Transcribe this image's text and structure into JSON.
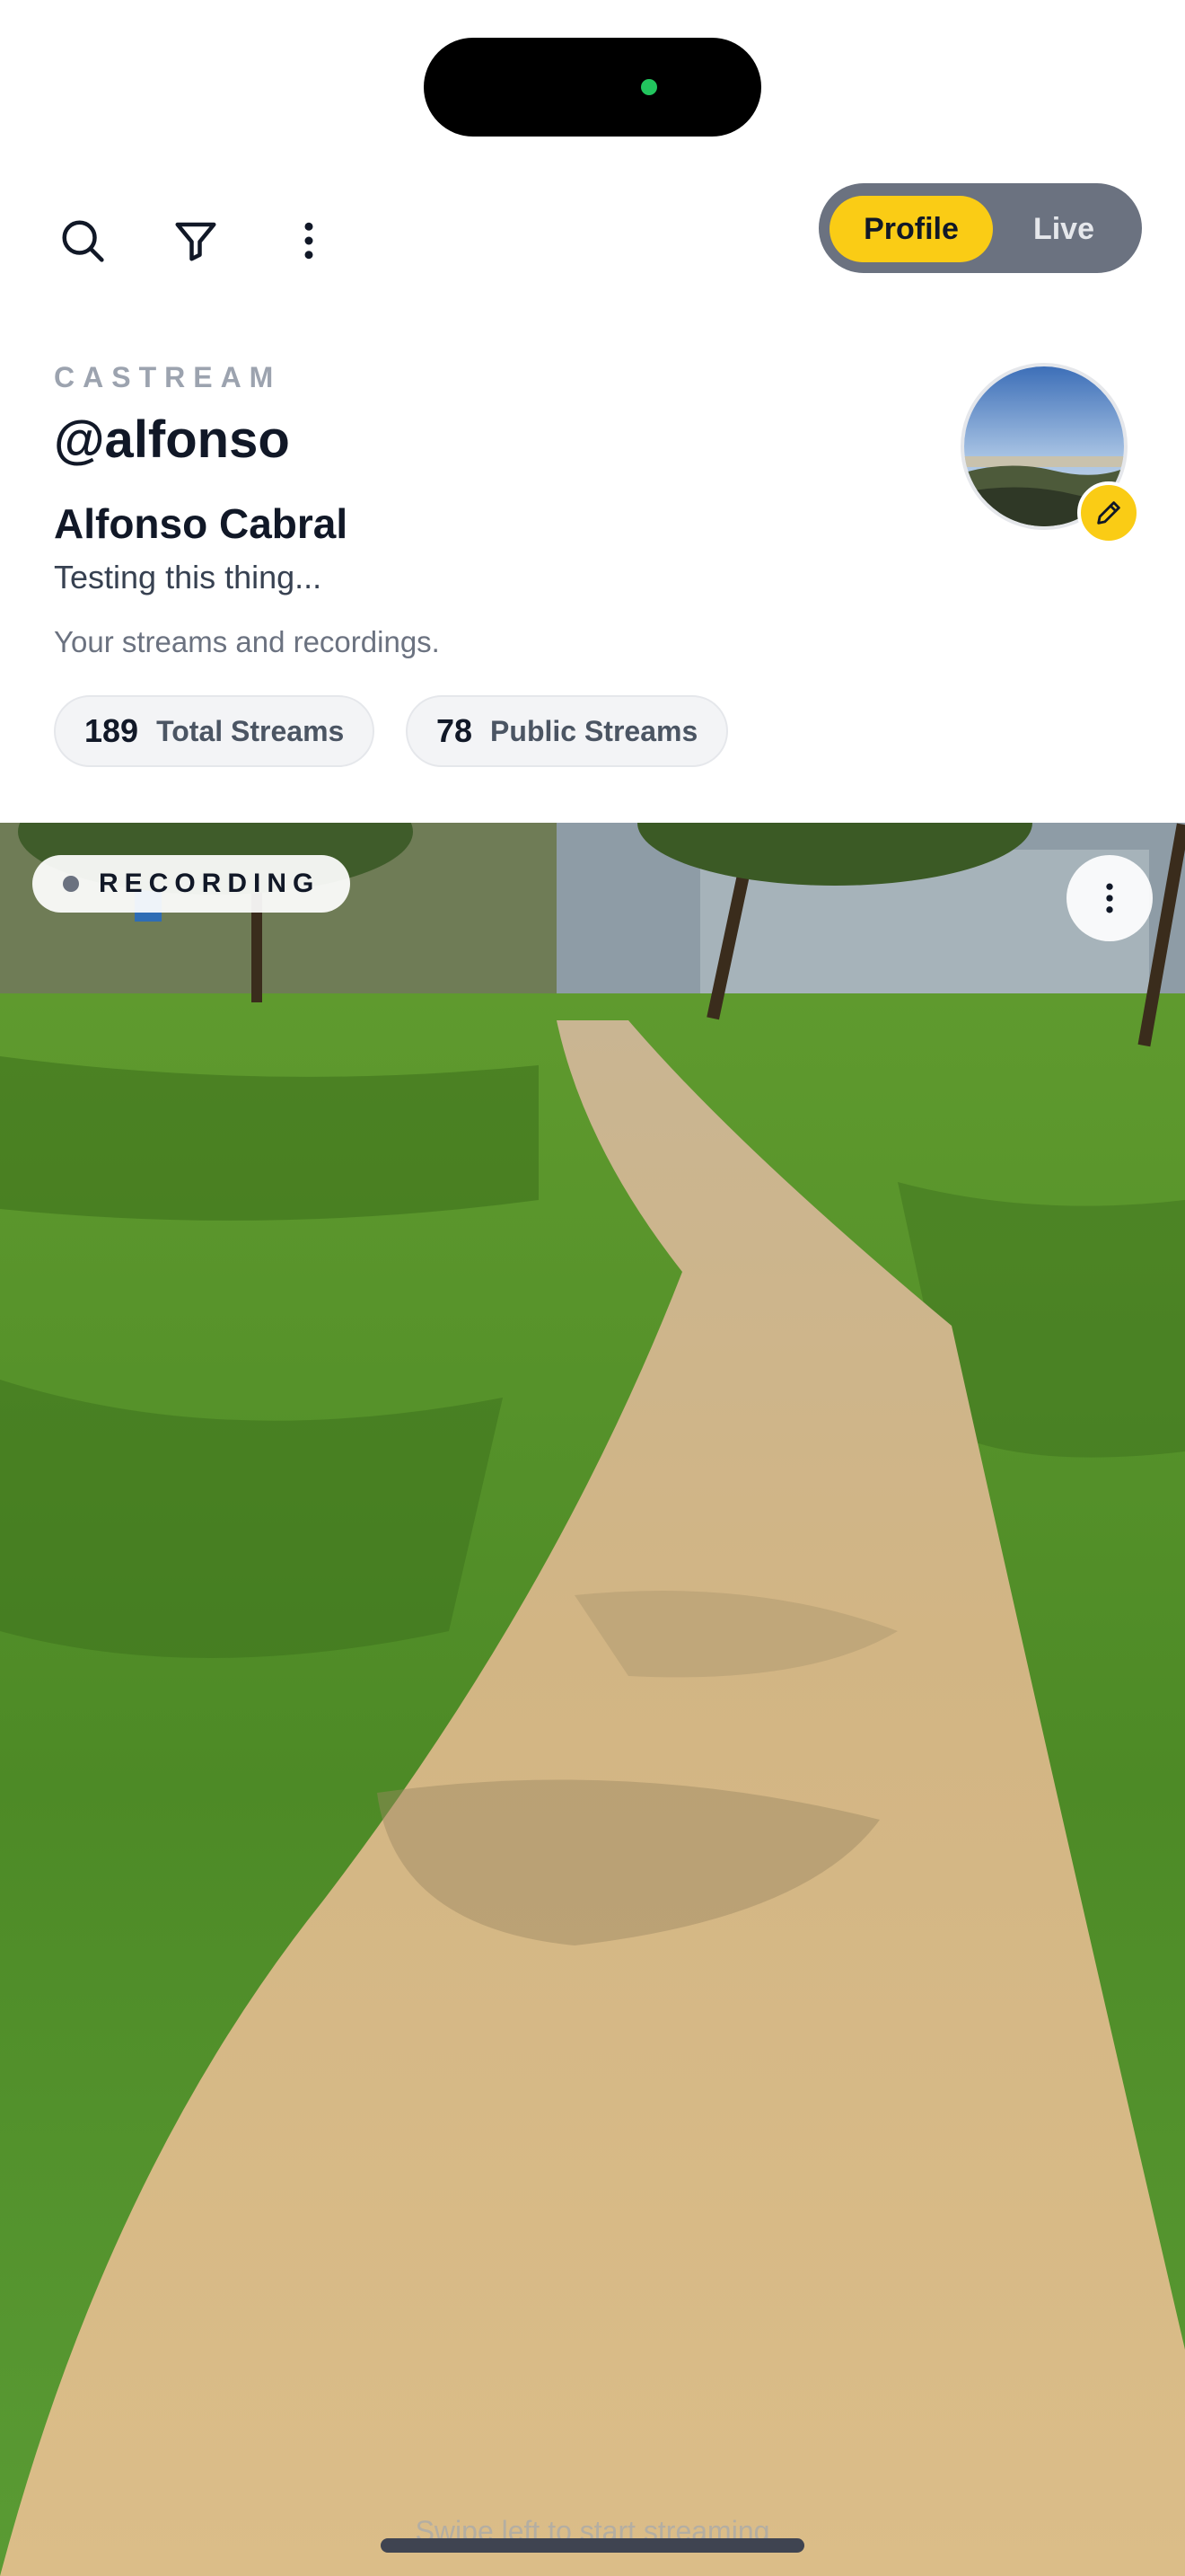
{
  "toolbar": {
    "icons": [
      "search-icon",
      "filter-icon",
      "more-vertical-icon"
    ],
    "segmented": {
      "profile_label": "Profile",
      "live_label": "Live",
      "selected": "Profile"
    }
  },
  "profile": {
    "brand": "CASTREAM",
    "handle": "@alfonso",
    "name": "Alfonso Cabral",
    "bio": "Testing this thing...",
    "subtitle": "Your streams and recordings.",
    "stats": {
      "total_count": "189",
      "total_label": "Total Streams",
      "public_count": "78",
      "public_label": "Public Streams"
    }
  },
  "video": {
    "status_badge": "RECORDING",
    "swipe_hint": "Swipe left to start streaming"
  },
  "colors": {
    "accent": "#facc15",
    "segment_bg": "#6b7280",
    "status_dot": "#22c55e"
  }
}
